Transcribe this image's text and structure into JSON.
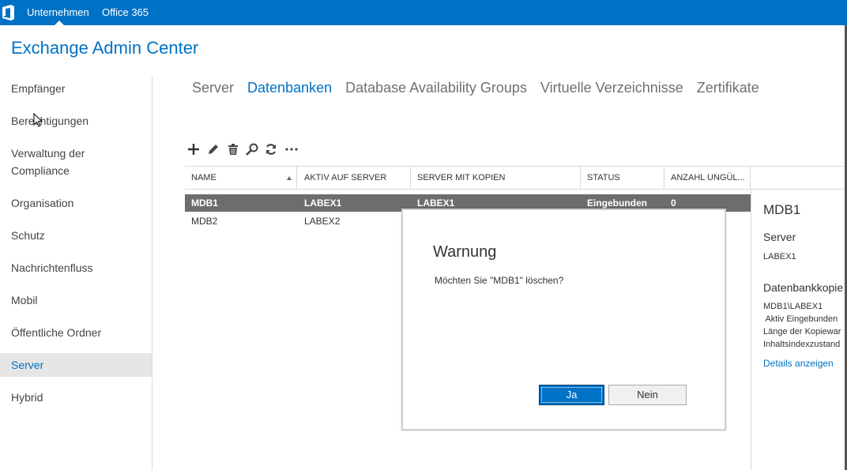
{
  "topbar": {
    "items": [
      "Unternehmen",
      "Office 365"
    ],
    "logo_icon": "office-logo-icon",
    "color": "#0072c6"
  },
  "app": {
    "title": "Exchange Admin Center"
  },
  "nav": {
    "items": [
      {
        "label": "Empfänger"
      },
      {
        "label": "Berechtigungen"
      },
      {
        "label": "Verwaltung der\nCompliance"
      },
      {
        "label": "Organisation"
      },
      {
        "label": "Schutz"
      },
      {
        "label": "Nachrichtenfluss"
      },
      {
        "label": "Mobil"
      },
      {
        "label": "Öffentliche Ordner"
      },
      {
        "label": "Server"
      },
      {
        "label": "Hybrid"
      }
    ],
    "active": "Server"
  },
  "tabs": {
    "items": [
      "Server",
      "Datenbanken",
      "Database Availability Groups",
      "Virtuelle Verzeichnisse",
      "Zertifikate"
    ],
    "active": "Datenbanken"
  },
  "toolbar": {
    "icons": [
      "add-icon",
      "edit-icon",
      "delete-icon",
      "search-icon",
      "refresh-icon",
      "more-icon"
    ]
  },
  "grid": {
    "columns": [
      "NAME",
      "AKTIV AUF SERVER",
      "SERVER MIT KOPIEN",
      "STATUS",
      "ANZAHL UNGÜL..."
    ],
    "rows": [
      {
        "name": "MDB1",
        "active_server": "LABEX1",
        "copies": "LABEX1",
        "status": "Eingebunden",
        "count": "0"
      },
      {
        "name": "MDB2",
        "active_server": "LABEX2",
        "copies": "",
        "status": "",
        "count": ""
      }
    ]
  },
  "details": {
    "title": "MDB1",
    "server_label": "Server",
    "server_value": "LABEX1",
    "copies_label": "Datenbankkopie",
    "copy_name": "MDB1\\LABEX1",
    "copy_line1": " Aktiv Eingebunden",
    "copy_line2": "Länge der Kopiewar",
    "copy_line3": "Inhaltsindexzustand",
    "details_link": "Details anzeigen"
  },
  "dialog": {
    "title": "Warnung",
    "message": "Möchten Sie \"MDB1\" löschen?",
    "yes": "Ja",
    "no": "Nein"
  }
}
